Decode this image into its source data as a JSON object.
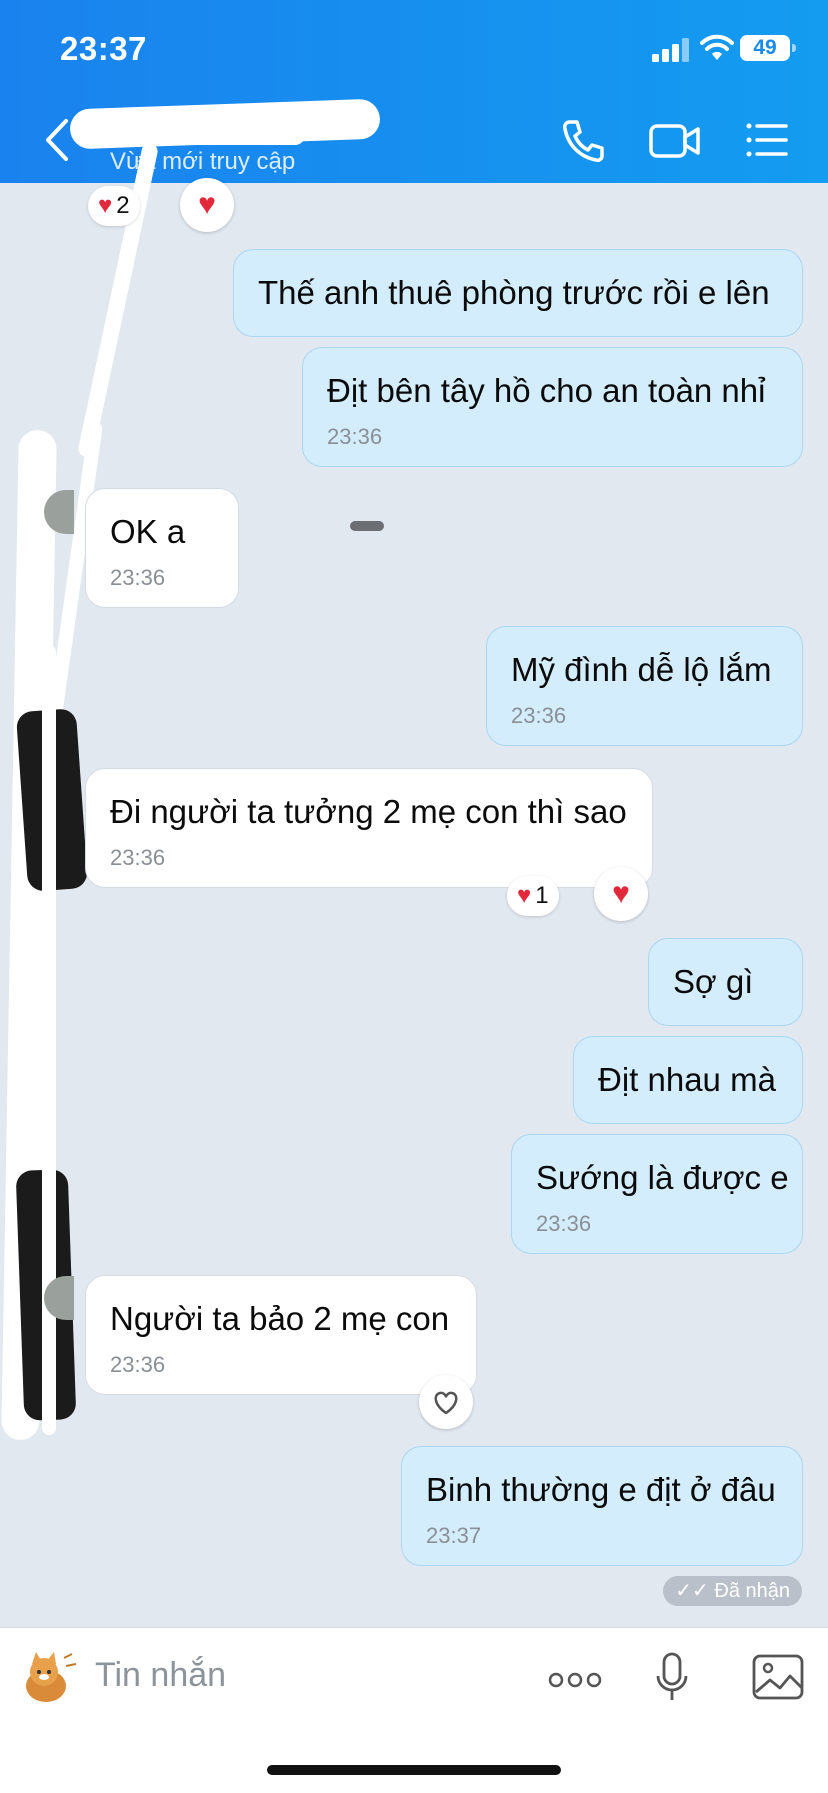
{
  "status_bar": {
    "time": "23:37",
    "battery": "49"
  },
  "header": {
    "contact_name": "",
    "contact_status": "Vừa mới truy cập"
  },
  "top_reaction": {
    "count": "2"
  },
  "messages": [
    {
      "side": "out",
      "text": "Thế anh thuê phòng trước rồi e lên",
      "time": ""
    },
    {
      "side": "out",
      "text": "Địt bên tây hồ cho an toàn nhỉ",
      "time": "23:36"
    },
    {
      "side": "in",
      "text": "OK a",
      "time": "23:36"
    },
    {
      "side": "out",
      "text": "Mỹ đình dễ lộ lắm",
      "time": "23:36"
    },
    {
      "side": "in",
      "text": "Đi người ta tưởng 2 mẹ con thì sao",
      "time": "23:36",
      "reaction_count": "1"
    },
    {
      "side": "out",
      "text": "Sợ gì",
      "time": ""
    },
    {
      "side": "out",
      "text": "Địt nhau mà",
      "time": ""
    },
    {
      "side": "out",
      "text": "Sướng là được e",
      "time": "23:36"
    },
    {
      "side": "in",
      "text": "Người ta bảo 2 mẹ con",
      "time": "23:36"
    },
    {
      "side": "out",
      "text": "Binh thường e địt ở đâu",
      "time": "23:37"
    }
  ],
  "delivery_status": "Đã nhận",
  "composer": {
    "placeholder": "Tin nhắn"
  },
  "colors": {
    "header_start": "#1a82ee",
    "header_end": "#139cf0",
    "outgoing_bubble": "#d4edfd",
    "incoming_bubble": "#ffffff",
    "reaction_heart": "#e2283b",
    "background": "#e2e8f0"
  },
  "icons": [
    "back-arrow-icon",
    "phone-icon",
    "video-camera-icon",
    "menu-list-icon",
    "heart-icon",
    "double-check-icon",
    "sticker-icon",
    "more-dots-icon",
    "microphone-icon",
    "image-icon"
  ]
}
